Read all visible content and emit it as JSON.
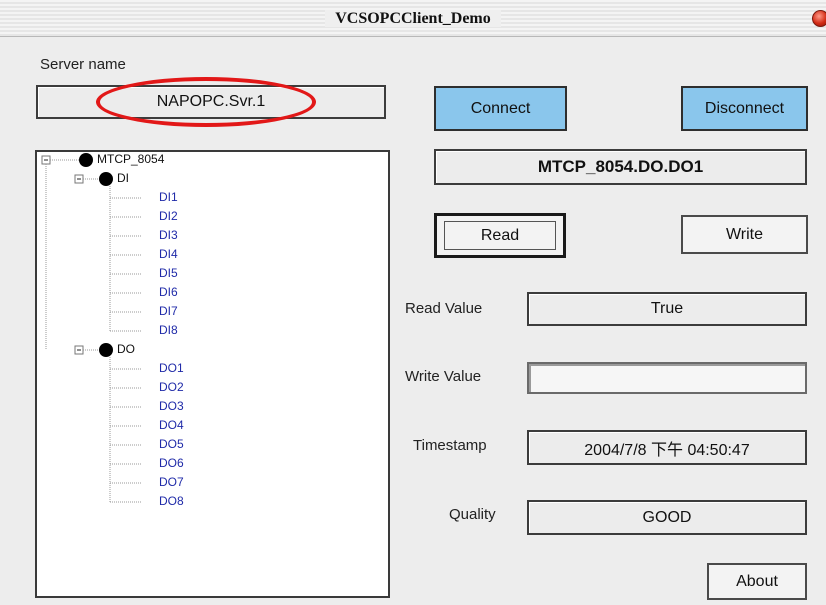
{
  "window": {
    "title": "VCSOPCClient_Demo"
  },
  "server": {
    "label": "Server name",
    "value": "NAPOPC.Svr.1"
  },
  "buttons": {
    "connect": "Connect",
    "disconnect": "Disconnect",
    "read": "Read",
    "write": "Write",
    "about": "About"
  },
  "selected_item": "MTCP_8054.DO.DO1",
  "fields": {
    "read_value": {
      "label": "Read Value",
      "value": "True"
    },
    "write_value": {
      "label": "Write Value",
      "value": ""
    },
    "timestamp": {
      "label": "Timestamp",
      "value": "2004/7/8 下午 04:50:47"
    },
    "quality": {
      "label": "Quality",
      "value": "GOOD"
    }
  },
  "tree": {
    "root": "MTCP_8054",
    "groups": [
      {
        "label": "DI",
        "items": [
          "DI1",
          "DI2",
          "DI3",
          "DI4",
          "DI5",
          "DI6",
          "DI7",
          "DI8"
        ]
      },
      {
        "label": "DO",
        "items": [
          "DO1",
          "DO2",
          "DO3",
          "DO4",
          "DO5",
          "DO6",
          "DO7",
          "DO8"
        ]
      }
    ]
  },
  "colors": {
    "button_blue": "#8ac6ec",
    "highlight_red": "#e21818",
    "tree_item_blue": "#1f2aa8"
  }
}
